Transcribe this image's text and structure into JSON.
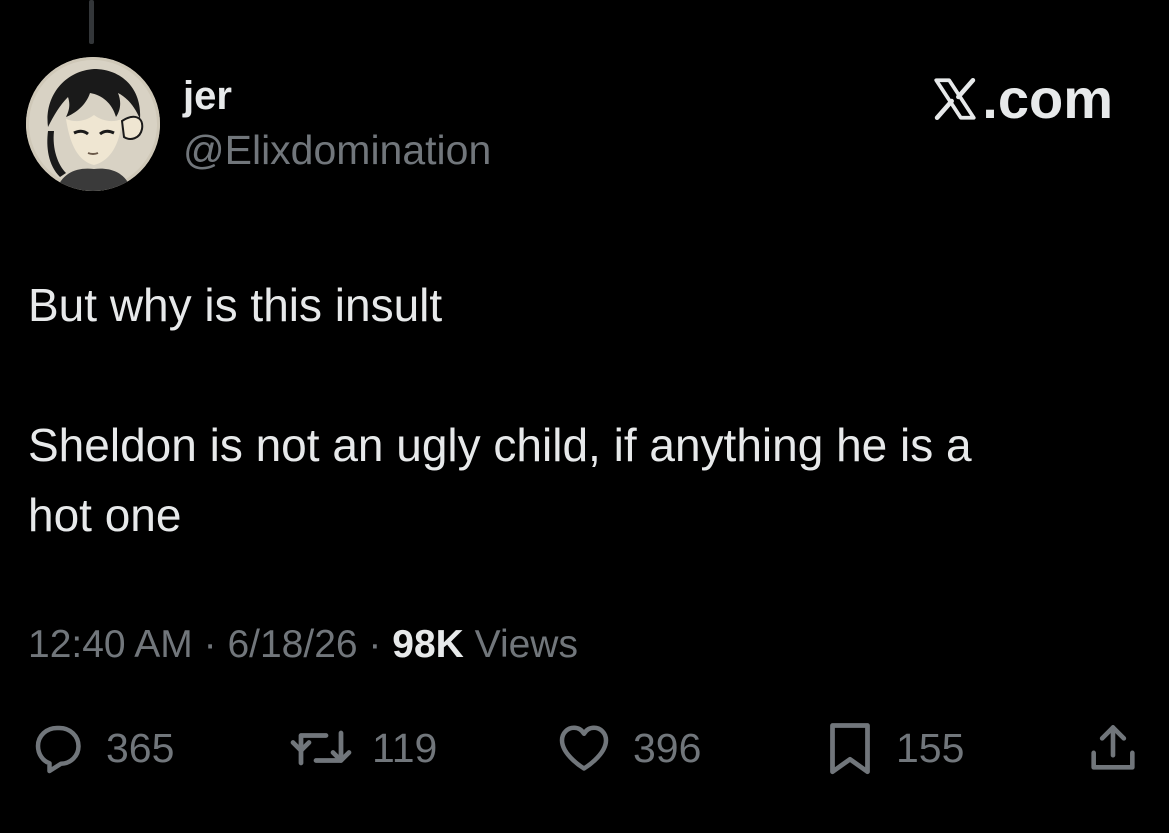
{
  "tweet": {
    "author": {
      "display_name": "jer",
      "handle": "@Elixdomination"
    },
    "brand": "X.com",
    "brand_suffix": ".com",
    "text_lines": [
      "But why is this insult",
      "Sheldon is not an ugly child, if anything he is a",
      "hot one"
    ],
    "meta": {
      "time": "12:40 AM",
      "separator": " · ",
      "date": "6/18/26",
      "views_count": "98K",
      "views_label": " Views"
    },
    "stats": {
      "replies": "365",
      "reposts": "119",
      "likes": "396",
      "bookmarks": "155"
    }
  },
  "icons": {
    "reply": "speech-bubble-icon",
    "repost": "repost-arrows-icon",
    "like": "heart-icon",
    "bookmark": "bookmark-icon",
    "share": "share-upload-icon"
  },
  "colors": {
    "background": "#000000",
    "text_primary": "#e7e9ea",
    "text_secondary": "#71767b"
  }
}
